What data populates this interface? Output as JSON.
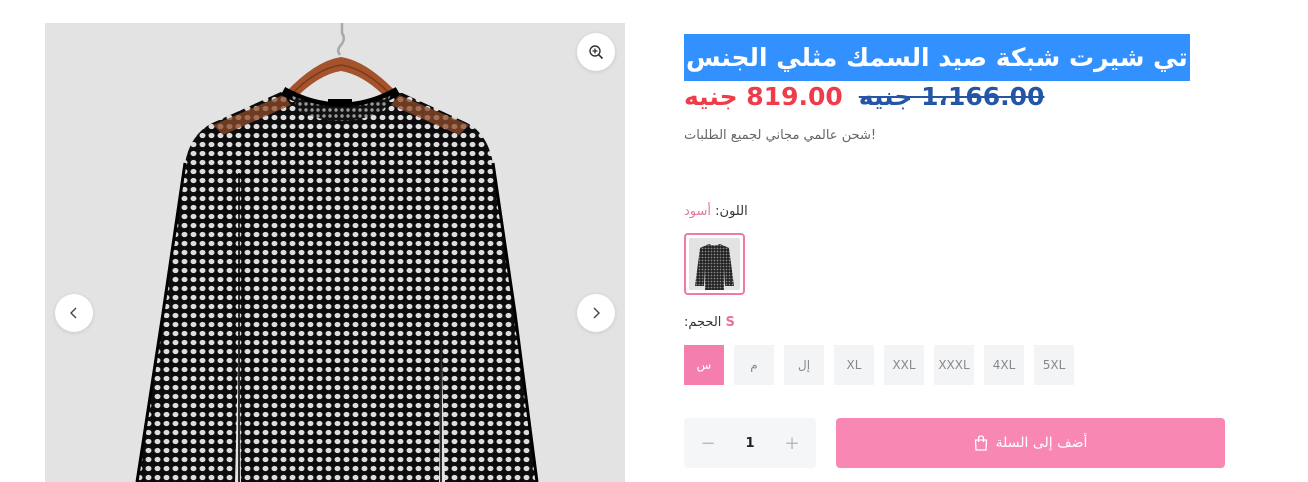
{
  "product": {
    "title": "تي شيرت شبكة صيد السمك مثلي الجنس",
    "price_new": "819.00 جنيه",
    "price_old": "1،166.00 جنيه",
    "shipping_note": "شحن عالمي مجاني لجميع الطلبات!"
  },
  "color": {
    "label": "اللون:",
    "value": "أسود"
  },
  "size": {
    "label": ":الحجم",
    "value": "S",
    "options": [
      "س",
      "م",
      "إل",
      "XL",
      "XXL",
      "XXXL",
      "4XL",
      "5XL"
    ],
    "selected_index": 0
  },
  "quantity": {
    "value": "1",
    "minus": "−",
    "plus": "+"
  },
  "cart": {
    "label": "أضف إلى السلة"
  },
  "icons": {
    "zoom": "zoom-in-icon",
    "prev": "chevron-left-icon",
    "next": "chevron-right-icon",
    "bag": "shopping-bag-icon"
  },
  "colors": {
    "accent_pink": "#f987b4",
    "sale_red": "#ef3b4a",
    "old_price_blue": "#2456a5",
    "selection_blue": "#3390ff"
  }
}
